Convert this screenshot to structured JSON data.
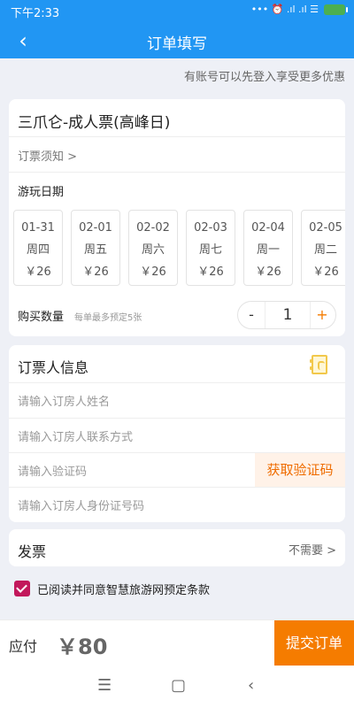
{
  "status_bar": {
    "time": "下午2:33",
    "icons_text": "•••  ⏰  .ıl  .ıl  ☰",
    "battery_icon": "battery-charging-icon",
    "colors": {
      "bar": "#2196f3",
      "battery": "#4caf50"
    }
  },
  "header": {
    "title": "订单填写",
    "back_icon": "chevron-left-icon"
  },
  "promo_text": "有账号可以先登入享受更多优惠",
  "ticket": {
    "name": "三爪仑-成人票(高峰日)",
    "notice": "订票须知 >",
    "date_title": "游玩日期",
    "dates": [
      {
        "date": "01-31",
        "weekday": "周四",
        "price": "￥26"
      },
      {
        "date": "02-01",
        "weekday": "周五",
        "price": "￥26"
      },
      {
        "date": "02-02",
        "weekday": "周六",
        "price": "￥26"
      },
      {
        "date": "02-03",
        "weekday": "周七",
        "price": "￥26"
      },
      {
        "date": "02-04",
        "weekday": "周一",
        "price": "￥26"
      },
      {
        "date": "02-05",
        "weekday": "周二",
        "price": "￥26"
      }
    ],
    "quantity_label": "购买数量",
    "quantity_hint": "每单最多预定5张",
    "quantity": "1",
    "minus": "-",
    "plus": "+"
  },
  "booker": {
    "title": "订票人信息",
    "fields": {
      "name": "请输入订房人姓名",
      "phone": "请输入订房人联系方式",
      "code": "请输入验证码",
      "id": "请输入订房人身份证号码"
    },
    "get_code": "获取验证码",
    "contact_icon": "contact-book-icon"
  },
  "invoice": {
    "label": "发票",
    "value": "不需要 >"
  },
  "agreement": {
    "text": "已阅读并同意智慧旅游网预定条款",
    "checked": true
  },
  "footer": {
    "label": "应付",
    "amount": "￥80",
    "submit": "提交订单"
  },
  "system_nav": {
    "menu": "☰",
    "home": "▢",
    "back": "‹"
  }
}
